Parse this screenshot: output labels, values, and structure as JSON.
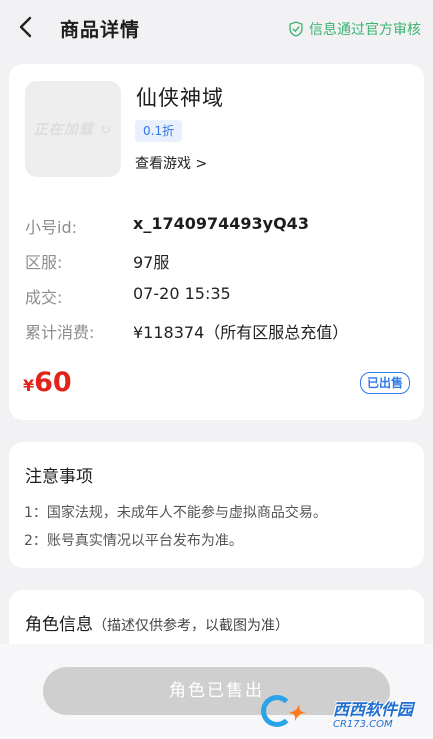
{
  "header": {
    "title": "商品详情",
    "verified_text": "信息通过官方审核",
    "accent_color": "#3cb371"
  },
  "product": {
    "thumbnail_text": "正在加载 ↻",
    "game_name": "仙侠神域",
    "discount": "0.1折",
    "view_game": "查看游戏 >",
    "info": [
      {
        "label": "小号id:",
        "value": "x_1740974493yQ43"
      },
      {
        "label": "区服:",
        "value": "97服"
      },
      {
        "label": "成交:",
        "value": "07-20 15:35"
      },
      {
        "label": "累计消费:",
        "value": "¥118374（所有区服总充值）"
      }
    ],
    "price_symbol": "¥",
    "price_value": "60",
    "price_color": "#e2231a",
    "status_badge": "已出售"
  },
  "notice": {
    "title": "注意事项",
    "items": [
      "1：国家法规，未成年人不能参与虚拟商品交易。",
      "2：账号真实情况以平台发布为准。"
    ]
  },
  "role": {
    "title": "角色信息",
    "subtitle": "（描述仅供参考，以截图为准）"
  },
  "bottom": {
    "button_label": "角色已售出"
  },
  "watermark": {
    "name": "西西软件园",
    "domain": "CR173.COM"
  }
}
